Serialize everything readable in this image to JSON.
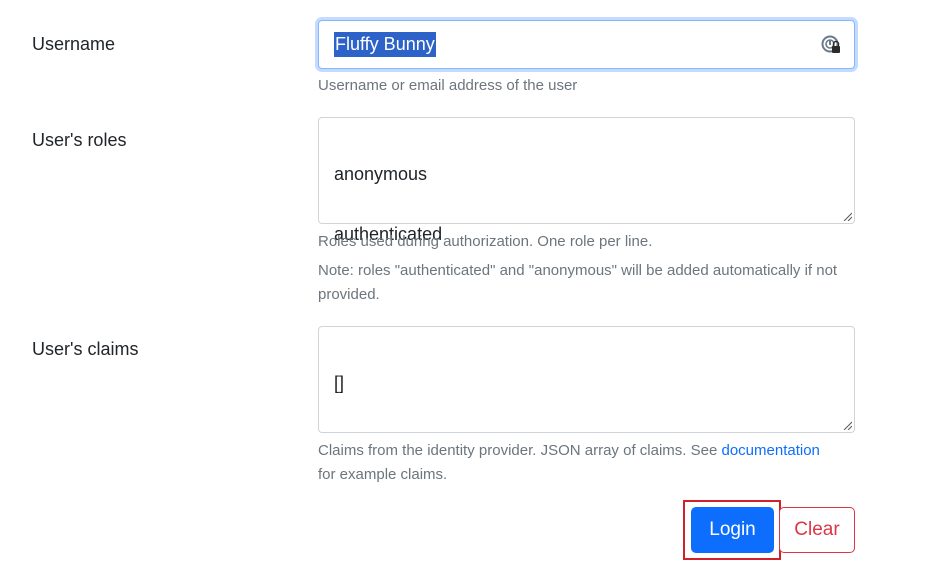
{
  "username": {
    "label": "Username",
    "value": "Fluffy Bunny",
    "help": "Username or email address of the user",
    "icon": "password-manager-icon"
  },
  "roles": {
    "label": "User's roles",
    "lines": [
      "anonymous",
      "authenticated"
    ],
    "help_1": "Roles used during authorization. One role per line.",
    "help_2": "Note: roles \"authenticated\" and \"anonymous\" will be added automatically if not provided."
  },
  "claims": {
    "label": "User's claims",
    "value": "[]",
    "help_prefix": "Claims from the identity provider. JSON array of claims. See ",
    "help_link": "documentation",
    "help_suffix": "for example claims."
  },
  "actions": {
    "login_label": "Login",
    "clear_label": "Clear"
  },
  "colors": {
    "primary": "#0d6efd",
    "danger": "#dc3545",
    "highlight": "#d0202a",
    "selection": "#2d62c9"
  }
}
